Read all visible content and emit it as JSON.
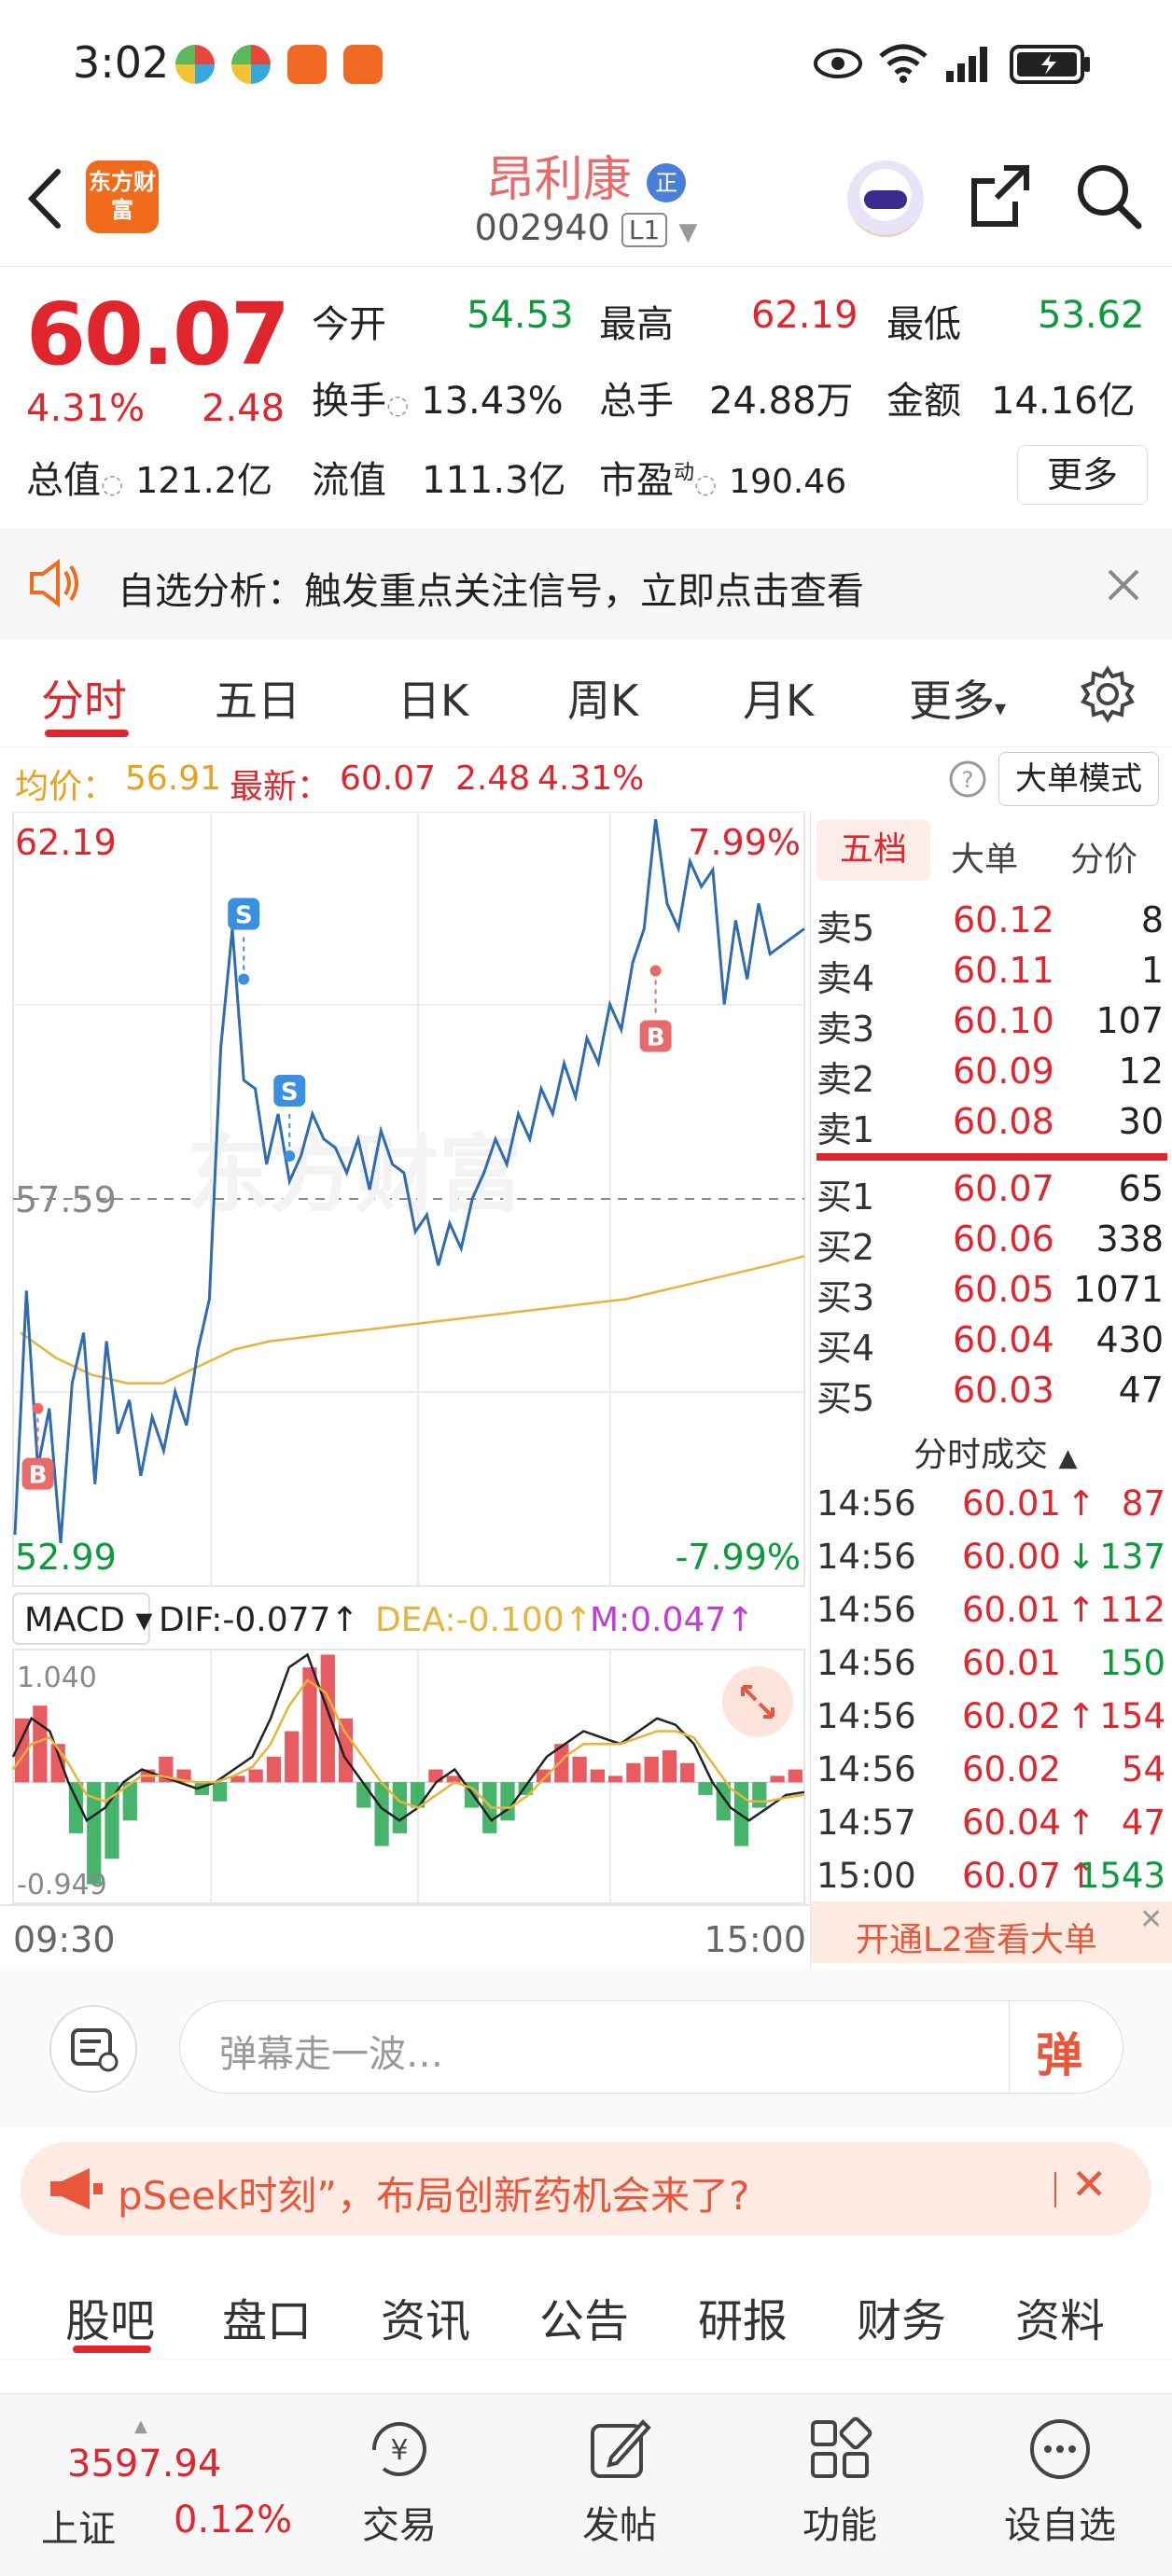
{
  "status_bar": {
    "time": "3:02"
  },
  "header": {
    "logo_text": "东方财富",
    "stock_name": "昂利康",
    "name_badge": "正",
    "stock_code": "002940",
    "level_badge": "L1"
  },
  "quote": {
    "price": "60.07",
    "change_pct": "4.31%",
    "change_amt": "2.48",
    "open_label": "今开",
    "open_value": "54.53",
    "high_label": "最高",
    "high_value": "62.19",
    "low_label": "最低",
    "low_value": "53.62",
    "turnover_label": "换手",
    "turnover_value": "13.43%",
    "volume_label": "总手",
    "volume_value": "24.88万",
    "amount_label": "金额",
    "amount_value": "14.16亿",
    "mktcap_label": "总值",
    "mktcap_value": "121.2亿",
    "float_label": "流值",
    "float_value": "111.3亿",
    "pe_label": "市盈",
    "pe_sup": "动",
    "pe_value": "190.46",
    "more_button": "更多"
  },
  "banner": {
    "text": "自选分析：触发重点关注信号，立即点击查看"
  },
  "tabs": [
    "分时",
    "五日",
    "日K",
    "周K",
    "月K",
    "更多"
  ],
  "info_line": {
    "avg_label": "均价：",
    "avg_value": "56.91",
    "latest_label": "最新：",
    "latest_value": "60.07",
    "change_amt": "2.48",
    "change_pct": "4.31%",
    "big_order_button": "大单模式"
  },
  "chart_data": {
    "type": "line",
    "y_left_top": "62.19",
    "y_left_mid": "57.59",
    "y_left_bottom": "52.99",
    "y_right_top": "7.99%",
    "y_right_bottom": "-7.99%",
    "ylim": [
      52.99,
      62.19
    ],
    "prev_close": 57.59,
    "x_start": "09:30",
    "x_end": "15:00",
    "price_series": [
      53.6,
      56.5,
      54.4,
      55.1,
      53.5,
      55.4,
      56.0,
      54.2,
      55.9,
      54.8,
      55.2,
      54.3,
      55.0,
      54.6,
      55.3,
      54.9,
      55.8,
      56.4,
      59.4,
      60.8,
      59.0,
      58.9,
      58.0,
      58.6,
      57.8,
      58.1,
      58.6,
      58.3,
      58.2,
      57.9,
      58.3,
      57.7,
      58.4,
      58.0,
      57.9,
      57.2,
      57.4,
      56.8,
      57.3,
      57.0,
      57.6,
      57.9,
      58.3,
      58.0,
      58.6,
      58.3,
      58.9,
      58.6,
      59.2,
      58.8,
      59.5,
      59.2,
      59.9,
      59.6,
      60.4,
      60.8,
      62.1,
      61.1,
      60.8,
      61.6,
      61.3,
      61.5,
      59.9,
      60.9,
      60.2,
      61.1,
      60.5,
      60.6,
      60.7,
      60.8
    ],
    "avg_series": [
      56.0,
      55.7,
      55.5,
      55.4,
      55.4,
      55.6,
      55.8,
      55.9,
      55.95,
      56.0,
      56.05,
      56.1,
      56.15,
      56.2,
      56.25,
      56.3,
      56.35,
      56.4,
      56.5,
      56.6,
      56.7,
      56.8,
      56.91
    ],
    "markers": [
      {
        "label": "B",
        "price": 55.1,
        "time_index": 2
      },
      {
        "label": "S",
        "price": 60.2,
        "time_index": 20
      },
      {
        "label": "S",
        "price": 58.1,
        "time_index": 24
      },
      {
        "label": "B",
        "price": 60.3,
        "time_index": 56
      }
    ],
    "macd": {
      "label": "MACD",
      "dif": "DIF:-0.077",
      "dea": "DEA:-0.100",
      "m": "M:0.047",
      "y_top": "1.040",
      "y_bottom": "-0.949",
      "bars": [
        0.5,
        0.6,
        0.3,
        -0.4,
        -0.8,
        -0.6,
        -0.3,
        0.1,
        0.2,
        0.1,
        -0.1,
        -0.15,
        0.05,
        0.1,
        0.2,
        0.4,
        0.9,
        1.0,
        0.5,
        -0.2,
        -0.5,
        -0.4,
        -0.2,
        0.1,
        0.05,
        -0.2,
        -0.4,
        -0.3,
        -0.1,
        0.1,
        0.3,
        0.2,
        0.1,
        0.05,
        0.15,
        0.2,
        0.25,
        0.15,
        -0.1,
        -0.3,
        -0.5,
        -0.2,
        0.05,
        0.1
      ],
      "dif_series": [
        0.2,
        0.5,
        0.4,
        0.0,
        -0.3,
        -0.2,
        0.0,
        0.1,
        0.05,
        0.0,
        -0.05,
        0.0,
        0.1,
        0.2,
        0.5,
        0.9,
        1.0,
        0.6,
        0.2,
        0.0,
        -0.2,
        -0.3,
        -0.2,
        0.0,
        0.1,
        -0.1,
        -0.3,
        -0.2,
        0.0,
        0.2,
        0.3,
        0.4,
        0.35,
        0.3,
        0.4,
        0.5,
        0.45,
        0.3,
        0.0,
        -0.2,
        -0.3,
        -0.2,
        -0.1,
        -0.077
      ],
      "dea_series": [
        0.1,
        0.3,
        0.35,
        0.15,
        -0.1,
        -0.15,
        -0.05,
        0.05,
        0.05,
        0.02,
        0.0,
        0.0,
        0.05,
        0.12,
        0.3,
        0.6,
        0.8,
        0.7,
        0.4,
        0.2,
        0.0,
        -0.15,
        -0.2,
        -0.1,
        0.0,
        -0.05,
        -0.2,
        -0.2,
        -0.1,
        0.05,
        0.2,
        0.3,
        0.3,
        0.3,
        0.35,
        0.4,
        0.4,
        0.35,
        0.15,
        -0.05,
        -0.15,
        -0.15,
        -0.12,
        -0.1
      ]
    }
  },
  "order_book": {
    "tabs": [
      "五档",
      "大单",
      "分价"
    ],
    "asks": [
      {
        "label": "卖5",
        "price": "60.12",
        "vol": "8"
      },
      {
        "label": "卖4",
        "price": "60.11",
        "vol": "1"
      },
      {
        "label": "卖3",
        "price": "60.10",
        "vol": "107"
      },
      {
        "label": "卖2",
        "price": "60.09",
        "vol": "12"
      },
      {
        "label": "卖1",
        "price": "60.08",
        "vol": "30"
      }
    ],
    "bids": [
      {
        "label": "买1",
        "price": "60.07",
        "vol": "65"
      },
      {
        "label": "买2",
        "price": "60.06",
        "vol": "338"
      },
      {
        "label": "买3",
        "price": "60.05",
        "vol": "1071"
      },
      {
        "label": "买4",
        "price": "60.04",
        "vol": "430"
      },
      {
        "label": "买5",
        "price": "60.03",
        "vol": "47"
      }
    ],
    "trades_title": "分时成交",
    "trades": [
      {
        "time": "14:56",
        "price": "60.01",
        "dir": "↑",
        "vol": "87",
        "color": "#e0262c"
      },
      {
        "time": "14:56",
        "price": "60.00",
        "dir": "↓",
        "vol": "137",
        "color": "#0a9b3a"
      },
      {
        "time": "14:56",
        "price": "60.01",
        "dir": "↑",
        "vol": "112",
        "color": "#e0262c"
      },
      {
        "time": "14:56",
        "price": "60.01",
        "dir": "",
        "vol": "150",
        "color": "#0a9b3a"
      },
      {
        "time": "14:56",
        "price": "60.02",
        "dir": "↑",
        "vol": "154",
        "color": "#e0262c"
      },
      {
        "time": "14:56",
        "price": "60.02",
        "dir": "",
        "vol": "54",
        "color": "#e0262c"
      },
      {
        "time": "14:57",
        "price": "60.04",
        "dir": "↑",
        "vol": "47",
        "color": "#e0262c"
      },
      {
        "time": "15:00",
        "price": "60.07",
        "dir": "↑",
        "vol": "1543",
        "color": "#0a9b3a"
      }
    ],
    "l2_text": "开通L2查看大单"
  },
  "comment_bar": {
    "placeholder": "弹幕走一波…",
    "danmu_label": "弹"
  },
  "news": {
    "text": "pSeek时刻”，布局创新药机会来了?"
  },
  "bottom_tabs": [
    "股吧",
    "盘口",
    "资讯",
    "公告",
    "研报",
    "财务",
    "资料"
  ],
  "nav": {
    "index_value": "3597.94",
    "index_name": "上证",
    "index_change": "0.12%",
    "items": [
      "交易",
      "发帖",
      "功能",
      "设自选"
    ]
  },
  "colors": {
    "accent": "#e0262c",
    "down": "#0a9b3a",
    "brand": "#f26a1b",
    "price_line": "#2e6bb0",
    "avg_line": "#e8b33a"
  }
}
